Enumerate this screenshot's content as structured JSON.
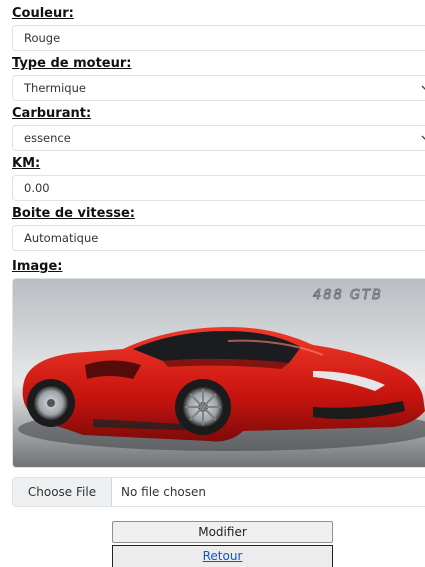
{
  "fields": {
    "couleur": {
      "label": "Couleur:",
      "value": "Rouge"
    },
    "type_moteur": {
      "label": "Type de moteur:",
      "value": "Thermique"
    },
    "carburant": {
      "label": "Carburant:",
      "value": "essence"
    },
    "km": {
      "label": "KM:",
      "value": "0.00"
    },
    "boite": {
      "label": "Boite de vitesse:",
      "value": "Automatique"
    },
    "image": {
      "label": "Image:",
      "watermark": "488 GTB"
    }
  },
  "file_input": {
    "button": "Choose File",
    "status": "No file chosen"
  },
  "buttons": {
    "modifier": "Modifier",
    "retour": "Retour"
  },
  "icons": {
    "select_arrow": "chevron-down-icon"
  },
  "colors": {
    "car_red": "#d11a1a",
    "link": "#0a58ca",
    "border": "#dee2e6"
  }
}
